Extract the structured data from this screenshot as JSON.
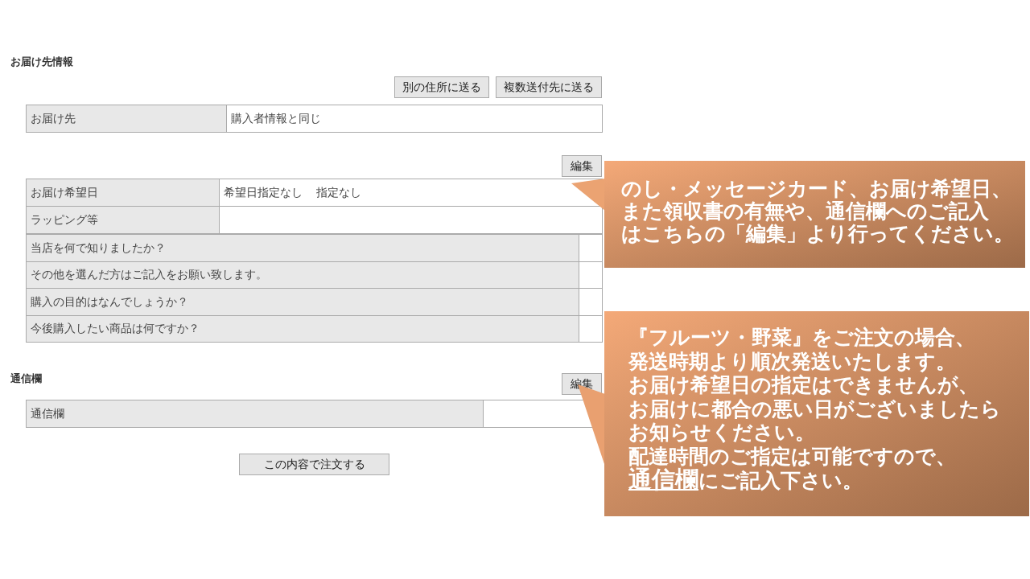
{
  "section_title": "お届け先情報",
  "address_buttons": [
    "別の住所に送る",
    "複数送付先に送る"
  ],
  "destination": {
    "label": "お届け先",
    "value": "購入者情報と同じ"
  },
  "options_edit_button": "編集",
  "delivery_rows": [
    {
      "label": "お届け希望日",
      "values": [
        "希望日指定なし",
        "指定なし"
      ]
    },
    {
      "label": "ラッピング等"
    }
  ],
  "survey_rows": [
    "当店を何で知りましたか？",
    "その他を選んだ方はご記入をお願い致します。",
    "購入の目的はなんでしょうか？",
    "今後購入したい商品は何ですか？"
  ],
  "message_section": {
    "title": "通信欄",
    "edit_button": "編集",
    "label": "通信欄"
  },
  "submit_button": "この内容で注文する",
  "callouts": [
    {
      "lines": [
        "のし・メッセージカード、お届け希望日、",
        "また領収書の有無や、通信欄へのご記入",
        "はこちらの「編集」より行ってください。"
      ]
    },
    {
      "lines": [
        "『フルーツ・野菜』をご注文の場合、",
        "発送時期より順次発送いたします。",
        "お届け希望日の指定はできませんが、",
        "お届けに都合の悪い日がございましたら",
        "お知らせください。",
        "配達時間のご指定は可能ですので、"
      ],
      "underlined": "通信欄",
      "after": "にご記入下さい。"
    }
  ]
}
